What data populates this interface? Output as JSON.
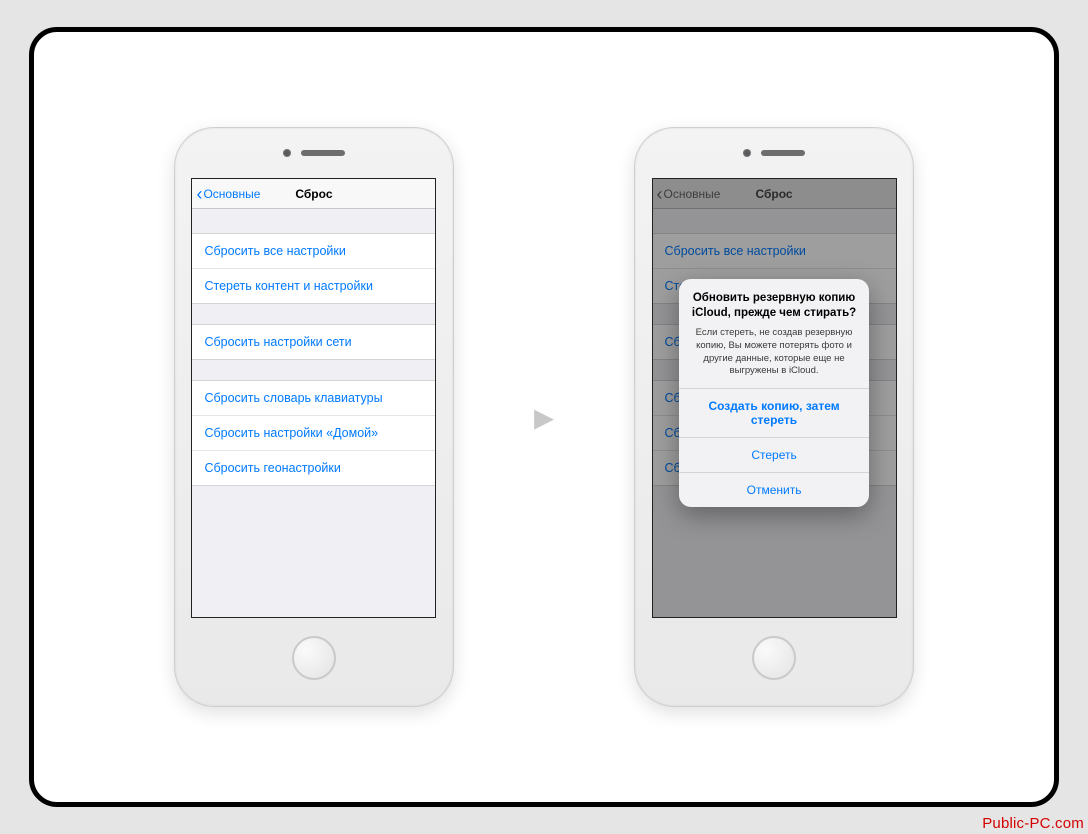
{
  "nav": {
    "back": "Основные",
    "title": "Сброс"
  },
  "rows": {
    "reset_all": "Сбросить все настройки",
    "erase_all": "Стереть контент и настройки",
    "reset_network": "Сбросить настройки сети",
    "reset_keyboard": "Сбросить словарь клавиатуры",
    "reset_home": "Сбросить настройки «Домой»",
    "reset_location": "Сбросить геонастройки"
  },
  "sheet": {
    "title": "Обновить резервную копию iCloud, прежде чем стирать?",
    "message": "Если стереть, не создав резервную копию, Вы можете потерять фото и другие данные, которые еще не выгружены в iCloud.",
    "backup_then_erase": "Создать копию, затем стереть",
    "erase": "Стереть",
    "cancel": "Отменить"
  },
  "watermark": "Public-PC.com"
}
